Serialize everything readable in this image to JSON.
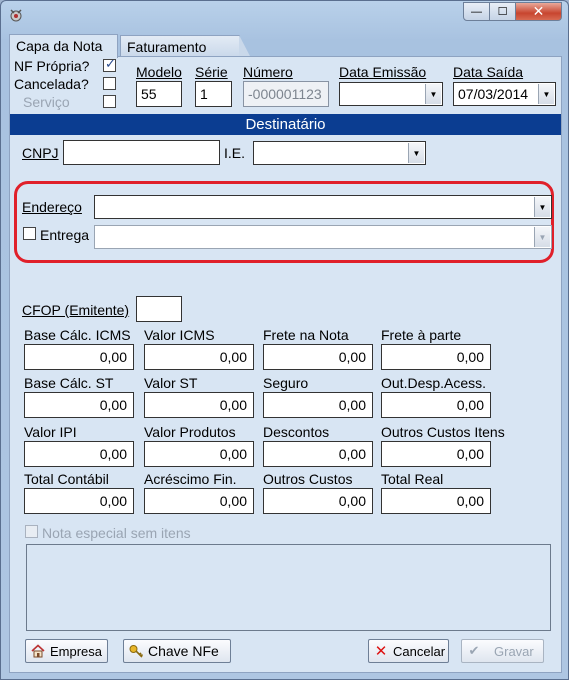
{
  "window": {
    "minimize_glyph": "—",
    "maximize_glyph": "☐",
    "close_glyph": "✕"
  },
  "tabs": [
    {
      "label": "Capa da Nota",
      "active": true
    },
    {
      "label": "Faturamento",
      "active": false
    }
  ],
  "header": {
    "nf_propria_label": "NF Própria?",
    "nf_propria_checked": true,
    "cancelada_label": "Cancelada?",
    "cancelada_checked": false,
    "servico_label": "Serviço",
    "servico_checked": false,
    "modelo_label": "Modelo",
    "modelo_value": "55",
    "serie_label": "Série",
    "serie_value": "1",
    "numero_label": "Número",
    "numero_value": "-000001123",
    "data_emissao_label": "Data Emissão",
    "data_emissao_value": "",
    "data_saida_label": "Data Saída",
    "data_saida_value": "07/03/2014"
  },
  "destinatario": {
    "section_title": "Destinatário",
    "cnpj_label": "CNPJ",
    "cnpj_value": "",
    "ie_label": "I.E.",
    "ie_value": "",
    "endereco_label": "Endereço",
    "endereco_value": "",
    "entrega_label": "Entrega",
    "entrega_checked": false,
    "entrega_value": ""
  },
  "cfop": {
    "label": "CFOP (Emitente)",
    "value": ""
  },
  "totals": [
    {
      "label": "Base Cálc. ICMS",
      "value": "0,00"
    },
    {
      "label": "Valor ICMS",
      "value": "0,00"
    },
    {
      "label": "Frete na Nota",
      "value": "0,00"
    },
    {
      "label": "Frete à parte",
      "value": "0,00"
    },
    {
      "label": "Base Cálc. ST",
      "value": "0,00"
    },
    {
      "label": "Valor ST",
      "value": "0,00"
    },
    {
      "label": "Seguro",
      "value": "0,00"
    },
    {
      "label": "Out.Desp.Acess.",
      "value": "0,00"
    },
    {
      "label": "Valor IPI",
      "value": "0,00"
    },
    {
      "label": "Valor Produtos",
      "value": "0,00"
    },
    {
      "label": "Descontos",
      "value": "0,00"
    },
    {
      "label": "Outros Custos Itens",
      "value": "0,00"
    },
    {
      "label": "Total Contábil",
      "value": "0,00"
    },
    {
      "label": "Acréscimo Fin.",
      "value": "0,00"
    },
    {
      "label": "Outros Custos",
      "value": "0,00"
    },
    {
      "label": "Total Real",
      "value": "0,00"
    }
  ],
  "nota_especial": {
    "label": "Nota especial sem itens",
    "checked": false
  },
  "observacoes": "",
  "buttons": {
    "empresa": "Empresa",
    "chave_nfe": "Chave NFe",
    "cancelar": "Cancelar",
    "gravar": "Gravar"
  },
  "colors": {
    "section_bar": "#0b3d91",
    "highlight": "#e0202a"
  }
}
